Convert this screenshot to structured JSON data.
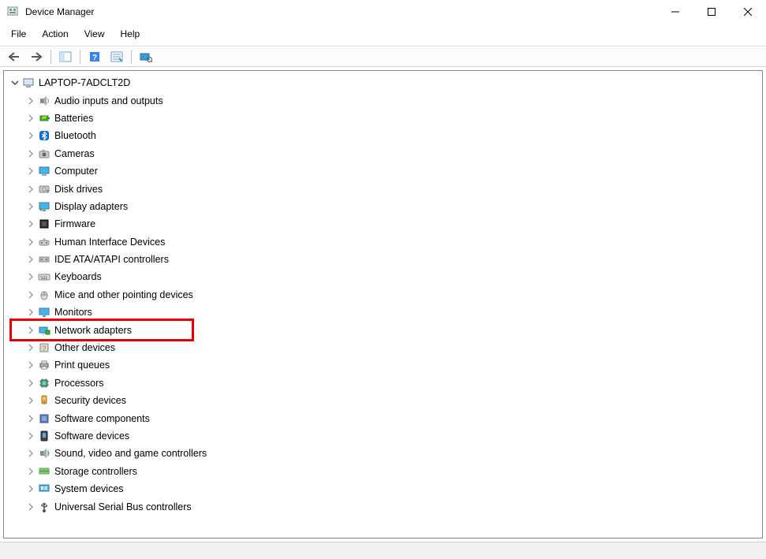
{
  "window": {
    "title": "Device Manager"
  },
  "menubar": {
    "items": [
      "File",
      "Action",
      "View",
      "Help"
    ]
  },
  "tree": {
    "root_label": "LAPTOP-7ADCLT2D",
    "categories": [
      {
        "label": "Audio inputs and outputs",
        "icon": "audio"
      },
      {
        "label": "Batteries",
        "icon": "battery"
      },
      {
        "label": "Bluetooth",
        "icon": "bluetooth"
      },
      {
        "label": "Cameras",
        "icon": "camera"
      },
      {
        "label": "Computer",
        "icon": "computer"
      },
      {
        "label": "Disk drives",
        "icon": "disk"
      },
      {
        "label": "Display adapters",
        "icon": "display"
      },
      {
        "label": "Firmware",
        "icon": "firmware"
      },
      {
        "label": "Human Interface Devices",
        "icon": "hid"
      },
      {
        "label": "IDE ATA/ATAPI controllers",
        "icon": "ide"
      },
      {
        "label": "Keyboards",
        "icon": "keyboard"
      },
      {
        "label": "Mice and other pointing devices",
        "icon": "mouse"
      },
      {
        "label": "Monitors",
        "icon": "monitor"
      },
      {
        "label": "Network adapters",
        "icon": "network",
        "highlighted": true
      },
      {
        "label": "Other devices",
        "icon": "other"
      },
      {
        "label": "Print queues",
        "icon": "printer"
      },
      {
        "label": "Processors",
        "icon": "cpu"
      },
      {
        "label": "Security devices",
        "icon": "security"
      },
      {
        "label": "Software components",
        "icon": "sw-component"
      },
      {
        "label": "Software devices",
        "icon": "sw-device"
      },
      {
        "label": "Sound, video and game controllers",
        "icon": "sound"
      },
      {
        "label": "Storage controllers",
        "icon": "storage"
      },
      {
        "label": "System devices",
        "icon": "system"
      },
      {
        "label": "Universal Serial Bus controllers",
        "icon": "usb"
      }
    ]
  }
}
